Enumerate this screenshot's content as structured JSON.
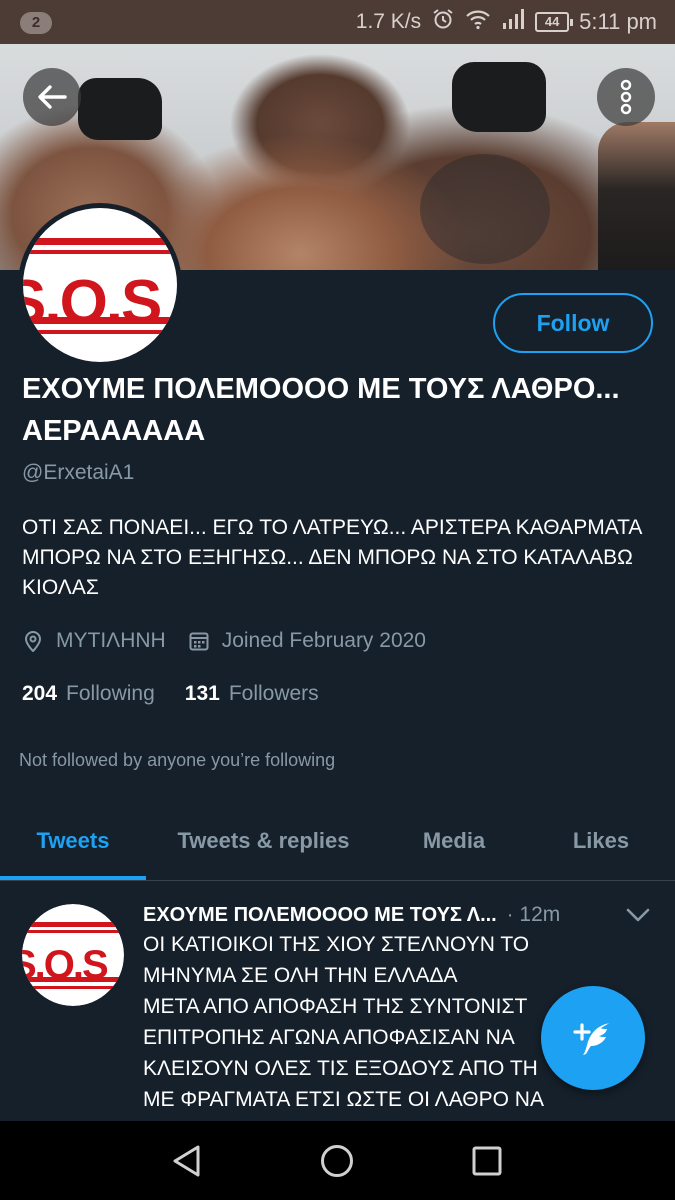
{
  "status_bar": {
    "notification_count": "2",
    "net_speed": "1.7 K/s",
    "battery": "44",
    "time": "5:11 pm",
    "icons": [
      "alarm-icon",
      "wifi-icon",
      "signal-icon",
      "battery-icon"
    ]
  },
  "header": {
    "back_icon": "arrow-left-icon",
    "more_icon": "more-vertical-icon"
  },
  "profile": {
    "avatar_text": "S.O.S",
    "follow_label": "Follow",
    "display_name": "ΕΧΟΥΜΕ ΠΟΛΕΜΟΟΟΟ ΜΕ ΤΟΥΣ ΛΑΘΡΟ... ΑΕΡΑΑΑΑΑΑ",
    "handle": "@ErxetaiA1",
    "bio": "ΟΤΙ ΣΑΣ ΠΟΝΑΕΙ... ΕΓΩ ΤΟ ΛΑΤΡΕΥΩ... ΑΡΙΣΤΕΡΑ ΚΑΘΑΡΜΑΤΑ ΜΠΟΡΩ ΝΑ ΣΤΟ ΕΞΗΓΗΣΩ... ΔΕΝ ΜΠΟΡΩ ΝΑ ΣΤΟ ΚΑΤΑΛΑΒΩ ΚΙΟΛΑΣ",
    "location": "ΜΥΤΙΛΗΝΗ",
    "joined": "Joined February 2020",
    "following_count": "204",
    "following_label": "Following",
    "followers_count": "131",
    "followers_label": "Followers",
    "not_followed_text": "Not followed by anyone you’re following"
  },
  "tabs": [
    {
      "label": "Tweets",
      "active": true
    },
    {
      "label": "Tweets & replies",
      "active": false
    },
    {
      "label": "Media",
      "active": false
    },
    {
      "label": "Likes",
      "active": false
    }
  ],
  "tweet": {
    "author": "ΕΧΟΥΜΕ ΠΟΛΕΜΟΟΟΟ ΜΕ ΤΟΥΣ Λ...",
    "dot": "·",
    "time": "12m",
    "text": "ΟΙ ΚΑΤΙΟΙΚΟΙ ΤΗΣ ΧΙΟΥ ΣΤΕΛΝΟΥΝ ΤΟ\nΜΗΝΥΜΑ ΣΕ ΟΛΗ ΤΗΝ ΕΛΛΑΔΑ\nΜΕΤΑ ΑΠΟ ΑΠΟΦΑΣΗ ΤΗΣ ΣΥΝΤΟΝΙΣΤ\nΕΠΙΤΡΟΠΗΣ ΑΓΩΝΑ ΑΠΟΦΑΣΙΣΑΝ ΝΑ\nΚΛΕΙΣΟΥΝ ΟΛΕΣ ΤΙΣ ΕΞΟΔΟΥΣ ΑΠΟ ΤΗ\nΜΕ ΦΡΑΓΜΑΤΑ ΕΤΣΙ ΩΣΤΕ ΟΙ ΛΑΘΡΟ ΝΑ\nΜΕΙΝΟΥΝ ΑΠΟΚΛΕΙΣΜΕΝΟΙ ΣΤΗΝ ΒΙΛΑ"
  },
  "fab": {
    "icon": "compose-tweet-icon"
  },
  "nav": {
    "icons": [
      "back-triangle-icon",
      "home-circle-icon",
      "recents-square-icon"
    ]
  },
  "colors": {
    "background": "#15202b",
    "accent": "#1da1f2",
    "secondary_text": "#8899a6",
    "status_bar": "#4d3c36",
    "logo_red": "#d1151d"
  }
}
